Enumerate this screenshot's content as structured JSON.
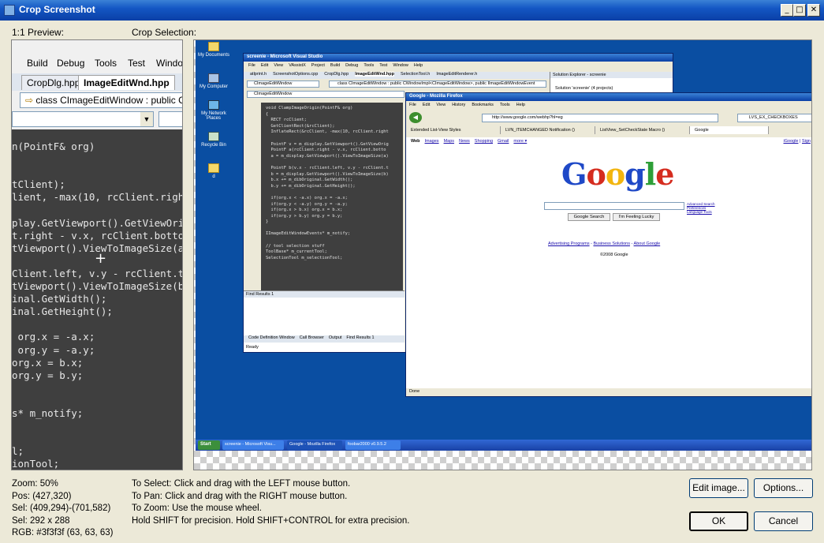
{
  "window": {
    "title": "Crop Screenshot"
  },
  "labels": {
    "preview": "1:1 Preview:",
    "crop": "Crop Selection:"
  },
  "preview": {
    "menu": [
      "Build",
      "Debug",
      "Tools",
      "Test",
      "Windo"
    ],
    "tabs": [
      "CropDlg.hpp",
      "ImageEditWnd.hpp"
    ],
    "classbar": "class CImageEditWindow : public CWi",
    "code": [
      "n(PointF& org)",
      "",
      "",
      "tClient);",
      "lient, -max(10, rcClient.right",
      "",
      "play.GetViewport().GetViewOrig",
      "t.right - v.x, rcClient.bottom",
      "tViewport().ViewToImageSize(a)",
      "",
      "Client.left, v.y - rcClient.t",
      "tViewport().ViewToImageSize(b)",
      "inal.GetWidth();",
      "inal.GetHeight();",
      "",
      " org.x = -a.x;",
      " org.y = -a.y;",
      "org.x = b.x;",
      "org.y = b.y;",
      "",
      "",
      "s* m_notify;",
      "",
      "",
      "l;",
      "ionTool;"
    ]
  },
  "desktop": {
    "icons": [
      "My Documents",
      "My Computer",
      "My Network Places",
      "Recycle Bin",
      "d"
    ],
    "vs": {
      "title": "screenie - Microsoft Visual Studio",
      "menu": [
        "File",
        "Edit",
        "View",
        "VAssistX",
        "Project",
        "Build",
        "Debug",
        "Tools",
        "Test",
        "Window",
        "Help"
      ],
      "tabs": [
        "atlprint.h",
        "ScreenshotOptions.cpp",
        "CropDlg.hpp",
        "ImageEditWnd.hpp",
        "SelectionTool.h",
        "ImageEditRenderer.h"
      ],
      "combo1": "CImageEditWindow",
      "combo2": "class CImageEditWindow : public CWindowImpl<CImageEditWindow>, public IImageEditWindowEvent",
      "code": [
        "void ClampImageOrigin(PointF& org)",
        "{",
        "  RECT rcClient;",
        "  GetClientRect(&rcClient);",
        "  InflateRect(&rcClient, -max(10, rcClient.right",
        "",
        "  PointF v = m_display.GetViewport().GetViewOrig",
        "  PointF a(rcClient.right - v.x, rcClient.botto",
        "  a = m_display.GetViewport().ViewToImageSize(a)",
        "",
        "  PointF b(v.x - rcClient.left, v.y - rcClient.t",
        "  b = m_display.GetViewport().ViewToImageSize(b)",
        "  b.x += m_dibOriginal.GetWidth();",
        "  b.y += m_dibOriginal.GetHeight();",
        "",
        "  if(org.x < -a.x) org.x = -a.x;",
        "  if(org.y < -a.y) org.y = -a.y;",
        "  if(org.x > b.x) org.x = b.x;",
        "  if(org.y > b.y) org.y = b.y;",
        "}",
        "",
        "IImageEditWindowEvents* m_notify;",
        "",
        "// tool selection stuff",
        "ToolBase* m_currentTool;",
        "SelectionTool m_selectionTool;"
      ],
      "find": "Find Results 1",
      "bottom_tabs": [
        "Code Definition Window",
        "Call Browser",
        "Output",
        "Find Results 1"
      ],
      "status": "Ready",
      "solution": "Solution Explorer - screenie",
      "solution_item": "Solution 'screenie' (4 projects)"
    },
    "ff": {
      "title": "Google - Mozilla Firefox",
      "menu": [
        "File",
        "Edit",
        "View",
        "History",
        "Bookmarks",
        "Tools",
        "Help"
      ],
      "url": "http://www.google.com/webhp?hl=eg",
      "search": "LVS_EX_CHECKBOXES",
      "bookmarks": [
        "Extended List-View Styles",
        "LVN_ITEMCHANGED Notification ()",
        "ListView_SetCheckState Macro ()",
        "Google"
      ],
      "nav": [
        "Web",
        "Images",
        "Maps",
        "News",
        "Shopping",
        "Gmail",
        "more ▾"
      ],
      "right_links": [
        "iGoogle",
        "Sign"
      ],
      "logo": [
        "G",
        "o",
        "o",
        "g",
        "l",
        "e"
      ],
      "logo_colors": [
        "#1f49c7",
        "#d52c1f",
        "#f2b50f",
        "#1f49c7",
        "#2e9f38",
        "#d52c1f"
      ],
      "buttons": [
        "Google Search",
        "I'm Feeling Lucky"
      ],
      "side_links": [
        "Advanced Search",
        "Preferences",
        "Language Tools"
      ],
      "footer_links": [
        "Advertising Programs",
        "Business Solutions",
        "About Google"
      ],
      "footer_sep": " - ",
      "copyright": "©2008 Google",
      "status": "Done"
    },
    "taskbar": {
      "start": "Start",
      "items": [
        "screenie - Microsoft Visu...",
        "Google - Mozilla Firefox",
        "foobar2000 v0.9.5.2"
      ]
    }
  },
  "info": {
    "left": [
      "Zoom: 50%",
      "Pos: (427,320)",
      "Sel: (409,294)-(701,582)",
      "Sel: 292 x 288",
      "RGB: #3f3f3f (63, 63, 63)"
    ],
    "right": [
      "To Select: Click and drag with the LEFT mouse button.",
      "To Pan: Click and drag with the RIGHT mouse button.",
      "To Zoom: Use the mouse wheel.",
      "Hold SHIFT for precision. Hold SHIFT+CONTROL for extra precision."
    ]
  },
  "buttons": {
    "edit": "Edit image...",
    "options": "Options...",
    "ok": "OK",
    "cancel": "Cancel"
  },
  "winbtns": {
    "min": "_",
    "max": "□",
    "close": "✕"
  }
}
